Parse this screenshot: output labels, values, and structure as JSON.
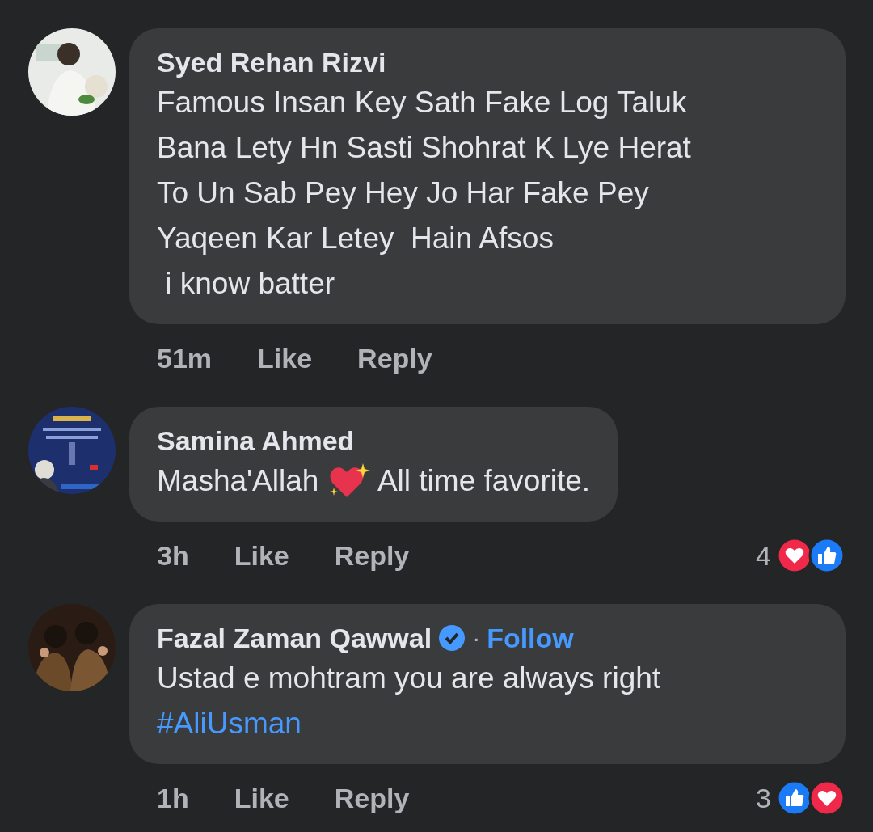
{
  "comments": [
    {
      "author": "Syed Rehan Rizvi",
      "body": [
        {
          "kind": "text",
          "text": "Famous Insan Key Sath Fake Log Taluk"
        },
        {
          "kind": "break"
        },
        {
          "kind": "text",
          "text": "Bana Lety Hn Sasti Shohrat K Lye Herat"
        },
        {
          "kind": "break"
        },
        {
          "kind": "text",
          "text": "To Un Sab Pey Hey Jo Har Fake Pey"
        },
        {
          "kind": "break"
        },
        {
          "kind": "text",
          "text": "Yaqeen Kar Letey  Hain Afsos"
        },
        {
          "kind": "break"
        },
        {
          "kind": "text",
          "text": " i know batter"
        }
      ],
      "time": "51m",
      "like": "Like",
      "reply": "Reply"
    },
    {
      "author": "Samina Ahmed",
      "body": [
        {
          "kind": "text",
          "text": "Masha'Allah "
        },
        {
          "kind": "emoji"
        },
        {
          "kind": "text",
          "text": " All time favorite."
        }
      ],
      "time": "3h",
      "like": "Like",
      "reply": "Reply",
      "reactions": {
        "count": "4",
        "icons": [
          {
            "kind": "love"
          },
          {
            "kind": "like"
          }
        ]
      }
    },
    {
      "author": "Fazal Zaman Qawwal",
      "verified": true,
      "follow": "Follow",
      "separator": "·",
      "body": [
        {
          "kind": "text",
          "text": "Ustad e mohtram you are always right"
        },
        {
          "kind": "break"
        },
        {
          "kind": "hashtag",
          "text": "#AliUsman"
        }
      ],
      "time": "1h",
      "like": "Like",
      "reply": "Reply",
      "reactions": {
        "count": "3",
        "icons": [
          {
            "kind": "like"
          },
          {
            "kind": "love"
          }
        ]
      }
    }
  ]
}
